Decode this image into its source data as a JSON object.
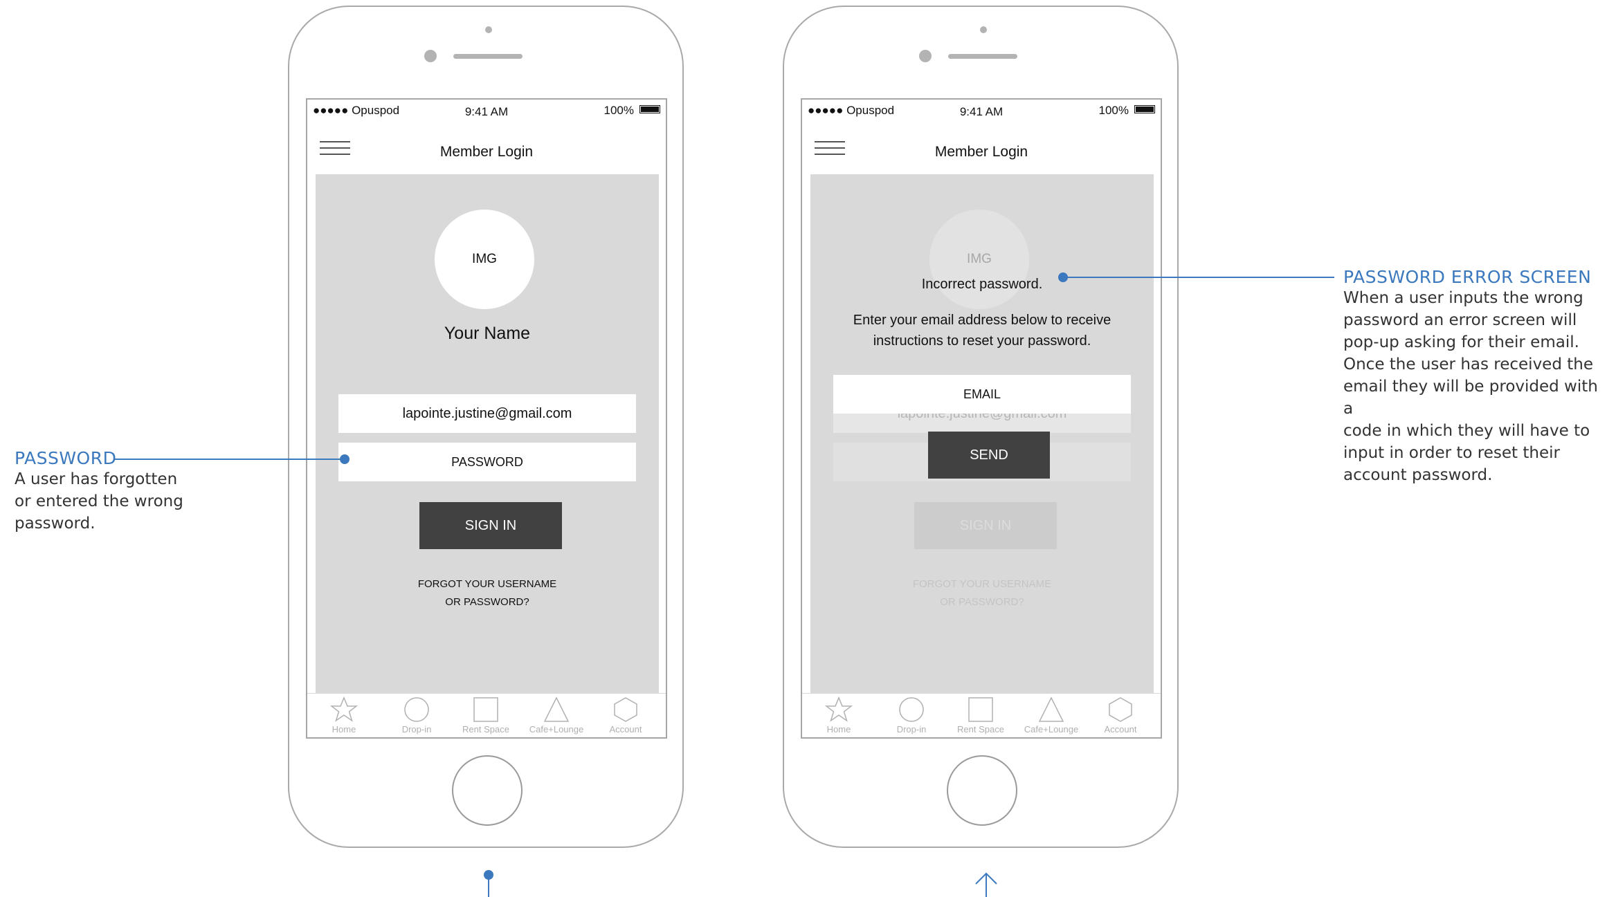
{
  "phone_left": {
    "carrier": "●●●●● Opuspod",
    "time": "9:41 AM",
    "battery": "100%",
    "nav_title": "Member Login",
    "avatar_label": "IMG",
    "your_name": "Your Name",
    "email_value": "lapointe.justine@gmail.com",
    "password_placeholder": "PASSWORD",
    "sign_in": "SIGN IN",
    "forgot_line1": "FORGOT YOUR USERNAME",
    "forgot_line2": "OR PASSWORD?"
  },
  "phone_right": {
    "carrier": "●●●●● Opuspod",
    "time": "9:41 AM",
    "battery": "100%",
    "nav_title": "Member Login",
    "avatar_label": "IMG",
    "error_message": "Incorrect password.",
    "instruction_line1": "Enter your email address below to receive",
    "instruction_line2": "instructions to reset your password.",
    "email_placeholder": "EMAIL",
    "send": "SEND",
    "faded_email": "lapointe.justine@gmail.com",
    "faded_sign_in": "SIGN IN",
    "faded_forgot_line1": "FORGOT YOUR USERNAME",
    "faded_forgot_line2": "OR PASSWORD?"
  },
  "tabs": [
    {
      "label": "Home",
      "icon": "star-icon"
    },
    {
      "label": "Drop-in",
      "icon": "circle-icon"
    },
    {
      "label": "Rent Space",
      "icon": "square-icon"
    },
    {
      "label": "Cafe+Lounge",
      "icon": "triangle-icon"
    },
    {
      "label": "Account",
      "icon": "hexagon-icon"
    }
  ],
  "annotations": {
    "password": {
      "title": "PASSWORD",
      "lines": [
        "A user has forgotten",
        "or entered the wrong",
        "password."
      ]
    },
    "error_screen": {
      "title": "PASSWORD ERROR SCREEN",
      "lines": [
        "When a user inputs the wrong",
        "password an error screen will",
        "pop-up asking for their email.",
        "Once the user has received the",
        "email they will be provided with a",
        "code in which they will have to",
        "input in order to reset their",
        "account password."
      ]
    }
  },
  "colors": {
    "annotation_blue": "#3b78bd",
    "content_gray": "#dad9da",
    "button_dark": "#414141"
  }
}
